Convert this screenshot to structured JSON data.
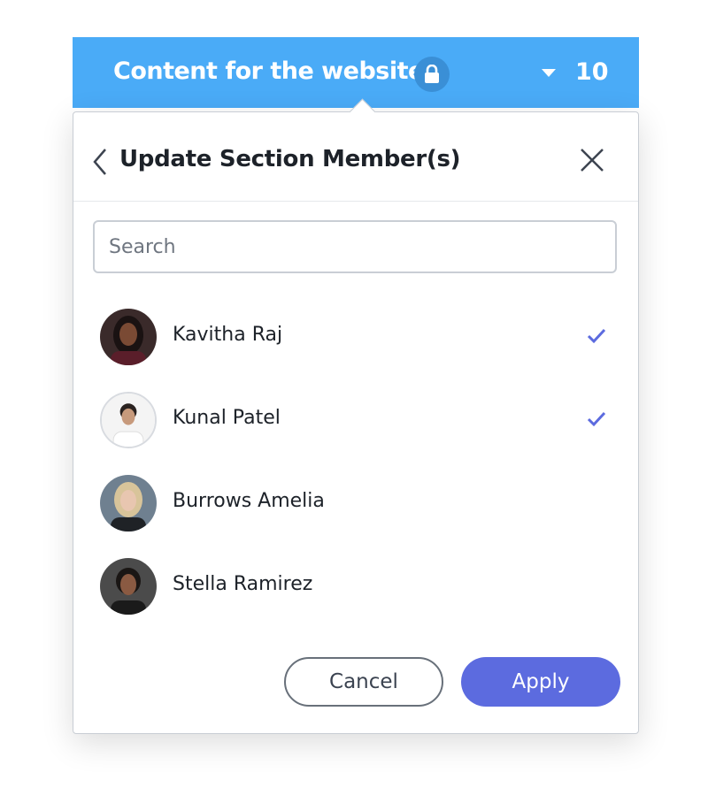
{
  "header": {
    "title": "Content for the website",
    "count": "10",
    "color": "#4aabf7"
  },
  "panel": {
    "title": "Update Section Member(s)",
    "search_placeholder": "Search"
  },
  "members": [
    {
      "name": "Kavitha Raj",
      "selected": true
    },
    {
      "name": "Kunal Patel",
      "selected": true
    },
    {
      "name": "Burrows Amelia",
      "selected": false
    },
    {
      "name": "Stella Ramirez",
      "selected": false
    }
  ],
  "actions": {
    "cancel_label": "Cancel",
    "apply_label": "Apply",
    "accent_color": "#5c6bdf"
  }
}
